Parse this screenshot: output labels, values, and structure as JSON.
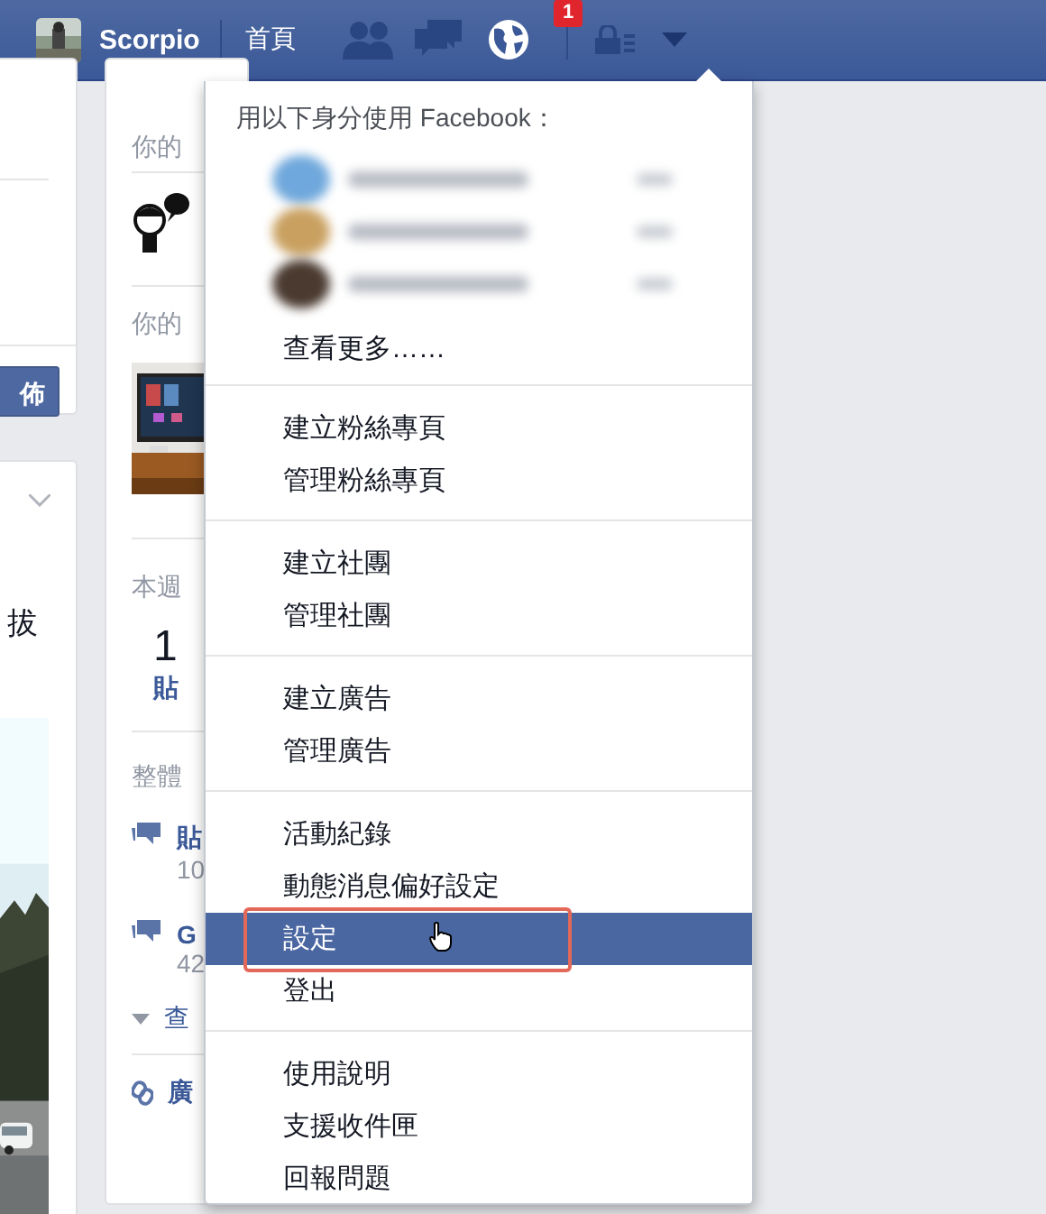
{
  "top_bar": {
    "user_name": "Scorpio",
    "home_link": "首頁",
    "notification_count": "1"
  },
  "left_column": {
    "publish_button": "佈",
    "post_text": "拔"
  },
  "middle_column": {
    "section_1_title": "你的",
    "section_2_title": "你的",
    "week_title": "本週",
    "week_count": "1",
    "week_link": "貼",
    "overall_title": "整體",
    "stats": [
      {
        "title": "貼",
        "value": "10"
      },
      {
        "title": "G",
        "value": "42"
      }
    ],
    "more_link": "查",
    "promo_link": "廣"
  },
  "account_menu": {
    "header": "用以下身分使用 Facebook：",
    "accounts": [
      {
        "kind": "blurred",
        "color": "#6fa8dc"
      },
      {
        "kind": "blurred",
        "color": "#c9a060"
      },
      {
        "kind": "blurred",
        "color": "#4a3a30"
      }
    ],
    "see_more": "查看更多……",
    "sections": [
      {
        "items": [
          {
            "label": "建立粉絲專頁",
            "selected": false
          },
          {
            "label": "管理粉絲專頁",
            "selected": false
          }
        ]
      },
      {
        "items": [
          {
            "label": "建立社團",
            "selected": false
          },
          {
            "label": "管理社團",
            "selected": false
          }
        ]
      },
      {
        "items": [
          {
            "label": "建立廣告",
            "selected": false
          },
          {
            "label": "管理廣告",
            "selected": false
          }
        ]
      },
      {
        "items": [
          {
            "label": "活動紀錄",
            "selected": false
          },
          {
            "label": "動態消息偏好設定",
            "selected": false
          },
          {
            "label": "設定",
            "selected": true
          },
          {
            "label": "登出",
            "selected": false
          }
        ]
      },
      {
        "items": [
          {
            "label": "使用說明",
            "selected": false
          },
          {
            "label": "支援收件匣",
            "selected": false
          },
          {
            "label": "回報問題",
            "selected": false
          }
        ]
      }
    ]
  }
}
